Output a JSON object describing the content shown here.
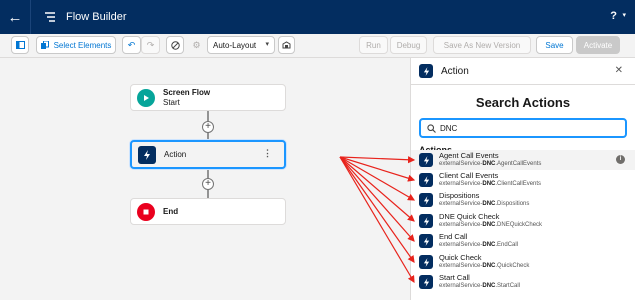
{
  "topbar": {
    "title": "Flow Builder",
    "help": "?",
    "help_caret": "▾",
    "back_glyph": "←"
  },
  "toolbar": {
    "select_elements": "Select Elements",
    "layout_value": "Auto-Layout",
    "run": "Run",
    "debug": "Debug",
    "save_as_new_version": "Save As New Version",
    "save": "Save",
    "activate": "Activate"
  },
  "canvas": {
    "nodes": [
      {
        "title": "Screen Flow",
        "subtitle": "Start"
      },
      {
        "title": "Action"
      },
      {
        "title": "End"
      }
    ],
    "more_glyph": "⋮",
    "plus_glyph": "+"
  },
  "panel": {
    "header_title": "Action",
    "close_glyph": "✕",
    "title": "Search Actions",
    "search_value": "DNC",
    "section_label": "Actions",
    "results": [
      {
        "name": "Agent Call Events",
        "api_prefix": "externalService-",
        "api_bold": "DNC",
        "api_suffix": ".AgentCallEvents"
      },
      {
        "name": "Client Call Events",
        "api_prefix": "externalService-",
        "api_bold": "DNC",
        "api_suffix": ".ClientCallEvents"
      },
      {
        "name": "Dispositions",
        "api_prefix": "externalService-",
        "api_bold": "DNC",
        "api_suffix": ".Dispositions"
      },
      {
        "name": "DNE Quick Check",
        "api_prefix": "externalService-",
        "api_bold": "DNC",
        "api_suffix": ".DNEQuickCheck"
      },
      {
        "name": "End Call",
        "api_prefix": "externalService-",
        "api_bold": "DNC",
        "api_suffix": ".EndCall"
      },
      {
        "name": "Quick Check",
        "api_prefix": "externalService-",
        "api_bold": "DNC",
        "api_suffix": ".QuickCheck"
      },
      {
        "name": "Start Call",
        "api_prefix": "externalService-",
        "api_bold": "DNC",
        "api_suffix": ".StartCall"
      }
    ],
    "info_glyph": "i"
  },
  "colors": {
    "header_bg": "#032d60",
    "accent_blue": "#0176d3",
    "start_green": "#06a59a",
    "end_red": "#ea001e",
    "arrow_red": "#e8231c"
  },
  "icons": {
    "app": "flow-icon",
    "start": "play-icon",
    "action": "lightning-icon",
    "end": "stop-icon",
    "search": "search-icon"
  }
}
